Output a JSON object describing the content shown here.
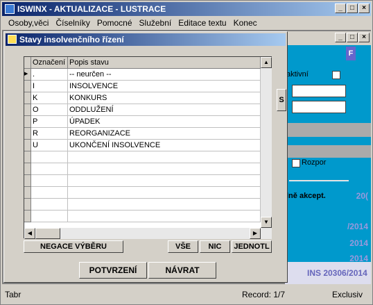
{
  "app": {
    "title": "ISWINX - AKTUALIZACE - LUSTRACE"
  },
  "window_controls": {
    "minimize": "_",
    "maximize": "□",
    "close": "×"
  },
  "menu": [
    "Osoby,věci",
    "Číselníky",
    "Pomocné",
    "Služební",
    "Editace textu",
    "Konec"
  ],
  "background_window": {
    "f_button": "F",
    "aktivni_label": "aktivní",
    "rozpor_label": "Rozpor",
    "akcept_label": "lně akcept.",
    "purple_values": [
      "20(",
      "/2014",
      "2014",
      "2014"
    ],
    "ins_label": "INS 20306/2014"
  },
  "dialog": {
    "title": "Stavy insolvenčního řízení",
    "side_button": "S",
    "columns": [
      "Označení",
      "Popis stavu"
    ],
    "rows": [
      {
        "code": ".",
        "desc": "-- neurčen --",
        "current": true
      },
      {
        "code": "I",
        "desc": "INSOLVENCE"
      },
      {
        "code": "K",
        "desc": "KONKURS"
      },
      {
        "code": "O",
        "desc": "ODDLUŽENÍ"
      },
      {
        "code": "P",
        "desc": "ÚPADEK"
      },
      {
        "code": "R",
        "desc": "REORGANIZACE"
      },
      {
        "code": "U",
        "desc": "UKONČENÍ INSOLVENCE"
      }
    ],
    "buttons": {
      "negace": "NEGACE VÝBĚRU",
      "vse": "VŠE",
      "nic": "NIC",
      "jednotl": "JEDNOTL",
      "potvrzeni": "POTVRZENÍ",
      "navrat": "NÁVRAT"
    }
  },
  "status": {
    "left": "Tabr",
    "record": "Record: 1/7",
    "right": "Exclusiv"
  }
}
